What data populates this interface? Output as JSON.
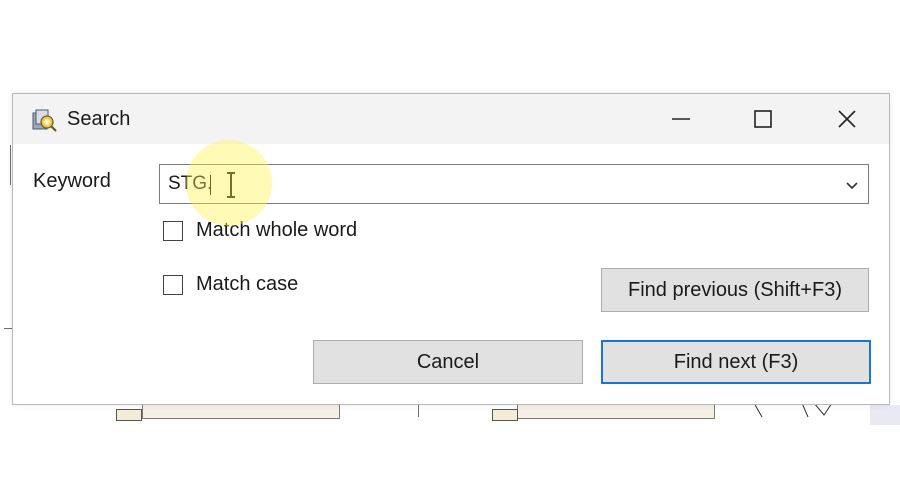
{
  "dialog": {
    "title": "Search",
    "title_icon": "app-search-icon",
    "controls": {
      "minimize_icon": "minimize-icon",
      "maximize_icon": "maximize-icon",
      "close_icon": "close-icon"
    }
  },
  "keyword": {
    "label": "Keyword",
    "value": "STG.",
    "dropdown_icon": "chevron-down-icon"
  },
  "options": {
    "match_whole_word": {
      "label": "Match whole word",
      "checked": false
    },
    "match_case": {
      "label": "Match case",
      "checked": false
    }
  },
  "buttons": {
    "find_previous": "Find previous (Shift+F3)",
    "cancel": "Cancel",
    "find_next": "Find next (F3)"
  },
  "colors": {
    "titlebar": "#f3f3f3",
    "button_face": "#e1e1e1",
    "default_button_border": "#1976d2",
    "cursor_highlight": "#fff550"
  }
}
